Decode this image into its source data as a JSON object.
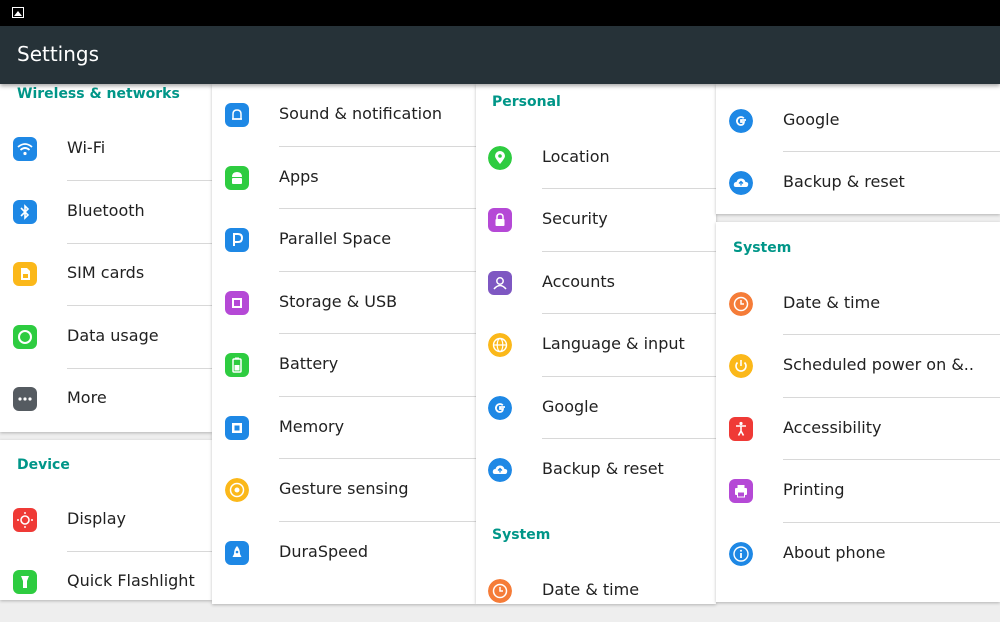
{
  "app": {
    "title": "Settings"
  },
  "colors": {
    "accent": "#009688",
    "appbar": "#263238",
    "background": "#eeeeee"
  },
  "columns": [
    {
      "sections": [
        {
          "header": "Wireless & networks",
          "items": [
            {
              "label": "Wi-Fi",
              "icon": "wifi-icon",
              "color": "#1e88e5"
            },
            {
              "label": "Bluetooth",
              "icon": "bluetooth-icon",
              "color": "#1e88e5"
            },
            {
              "label": "SIM cards",
              "icon": "sim-card-icon",
              "color": "#fbb81a"
            },
            {
              "label": "Data usage",
              "icon": "data-usage-icon",
              "color": "#2ecc40"
            },
            {
              "label": "More",
              "icon": "more-icon",
              "color": "#555b61"
            }
          ]
        },
        {
          "header": "Device",
          "items": [
            {
              "label": "Display",
              "icon": "display-icon",
              "color": "#ef3a36"
            },
            {
              "label": "Quick Flashlight",
              "icon": "flashlight-icon",
              "color": "#2ecc40"
            }
          ]
        }
      ]
    },
    {
      "sections": [
        {
          "header": "",
          "items": [
            {
              "label": "Sound & notification",
              "icon": "bell-icon",
              "color": "#1e88e5"
            },
            {
              "label": "Apps",
              "icon": "android-icon",
              "color": "#2ecc40"
            },
            {
              "label": "Parallel Space",
              "icon": "parallel-space-icon",
              "color": "#1e88e5"
            },
            {
              "label": "Storage & USB",
              "icon": "storage-icon",
              "color": "#b549d6"
            },
            {
              "label": "Battery",
              "icon": "battery-icon",
              "color": "#2ecc40"
            },
            {
              "label": "Memory",
              "icon": "memory-icon",
              "color": "#1e88e5"
            },
            {
              "label": "Gesture sensing",
              "icon": "gesture-icon",
              "color": "#fbb81a"
            },
            {
              "label": "DuraSpeed",
              "icon": "rocket-icon",
              "color": "#1e88e5"
            }
          ]
        }
      ]
    },
    {
      "sections": [
        {
          "header": "Personal",
          "items": [
            {
              "label": "Location",
              "icon": "location-icon",
              "color": "#2ecc40"
            },
            {
              "label": "Security",
              "icon": "lock-icon",
              "color": "#b549d6"
            },
            {
              "label": "Accounts",
              "icon": "account-icon",
              "color": "#7e57c2"
            },
            {
              "label": "Language & input",
              "icon": "globe-icon",
              "color": "#fbb81a"
            },
            {
              "label": "Google",
              "icon": "google-icon",
              "color": "#1e88e5"
            },
            {
              "label": "Backup & reset",
              "icon": "cloud-upload-icon",
              "color": "#1e88e5"
            }
          ]
        },
        {
          "header": "System",
          "items": [
            {
              "label": "Date & time",
              "icon": "clock-icon",
              "color": "#f57c38"
            }
          ]
        }
      ]
    },
    {
      "sections": [
        {
          "header": "",
          "items": [
            {
              "label": "Google",
              "icon": "google-icon",
              "color": "#1e88e5"
            },
            {
              "label": "Backup & reset",
              "icon": "cloud-upload-icon",
              "color": "#1e88e5"
            }
          ]
        },
        {
          "header": "System",
          "items": [
            {
              "label": "Date & time",
              "icon": "clock-icon",
              "color": "#f57c38"
            },
            {
              "label": "Scheduled power on &..",
              "icon": "power-schedule-icon",
              "color": "#fbb81a"
            },
            {
              "label": "Accessibility",
              "icon": "accessibility-icon",
              "color": "#ef3a36"
            },
            {
              "label": "Printing",
              "icon": "printer-icon",
              "color": "#b549d6"
            },
            {
              "label": "About phone",
              "icon": "info-icon",
              "color": "#1e88e5"
            }
          ]
        }
      ]
    }
  ]
}
